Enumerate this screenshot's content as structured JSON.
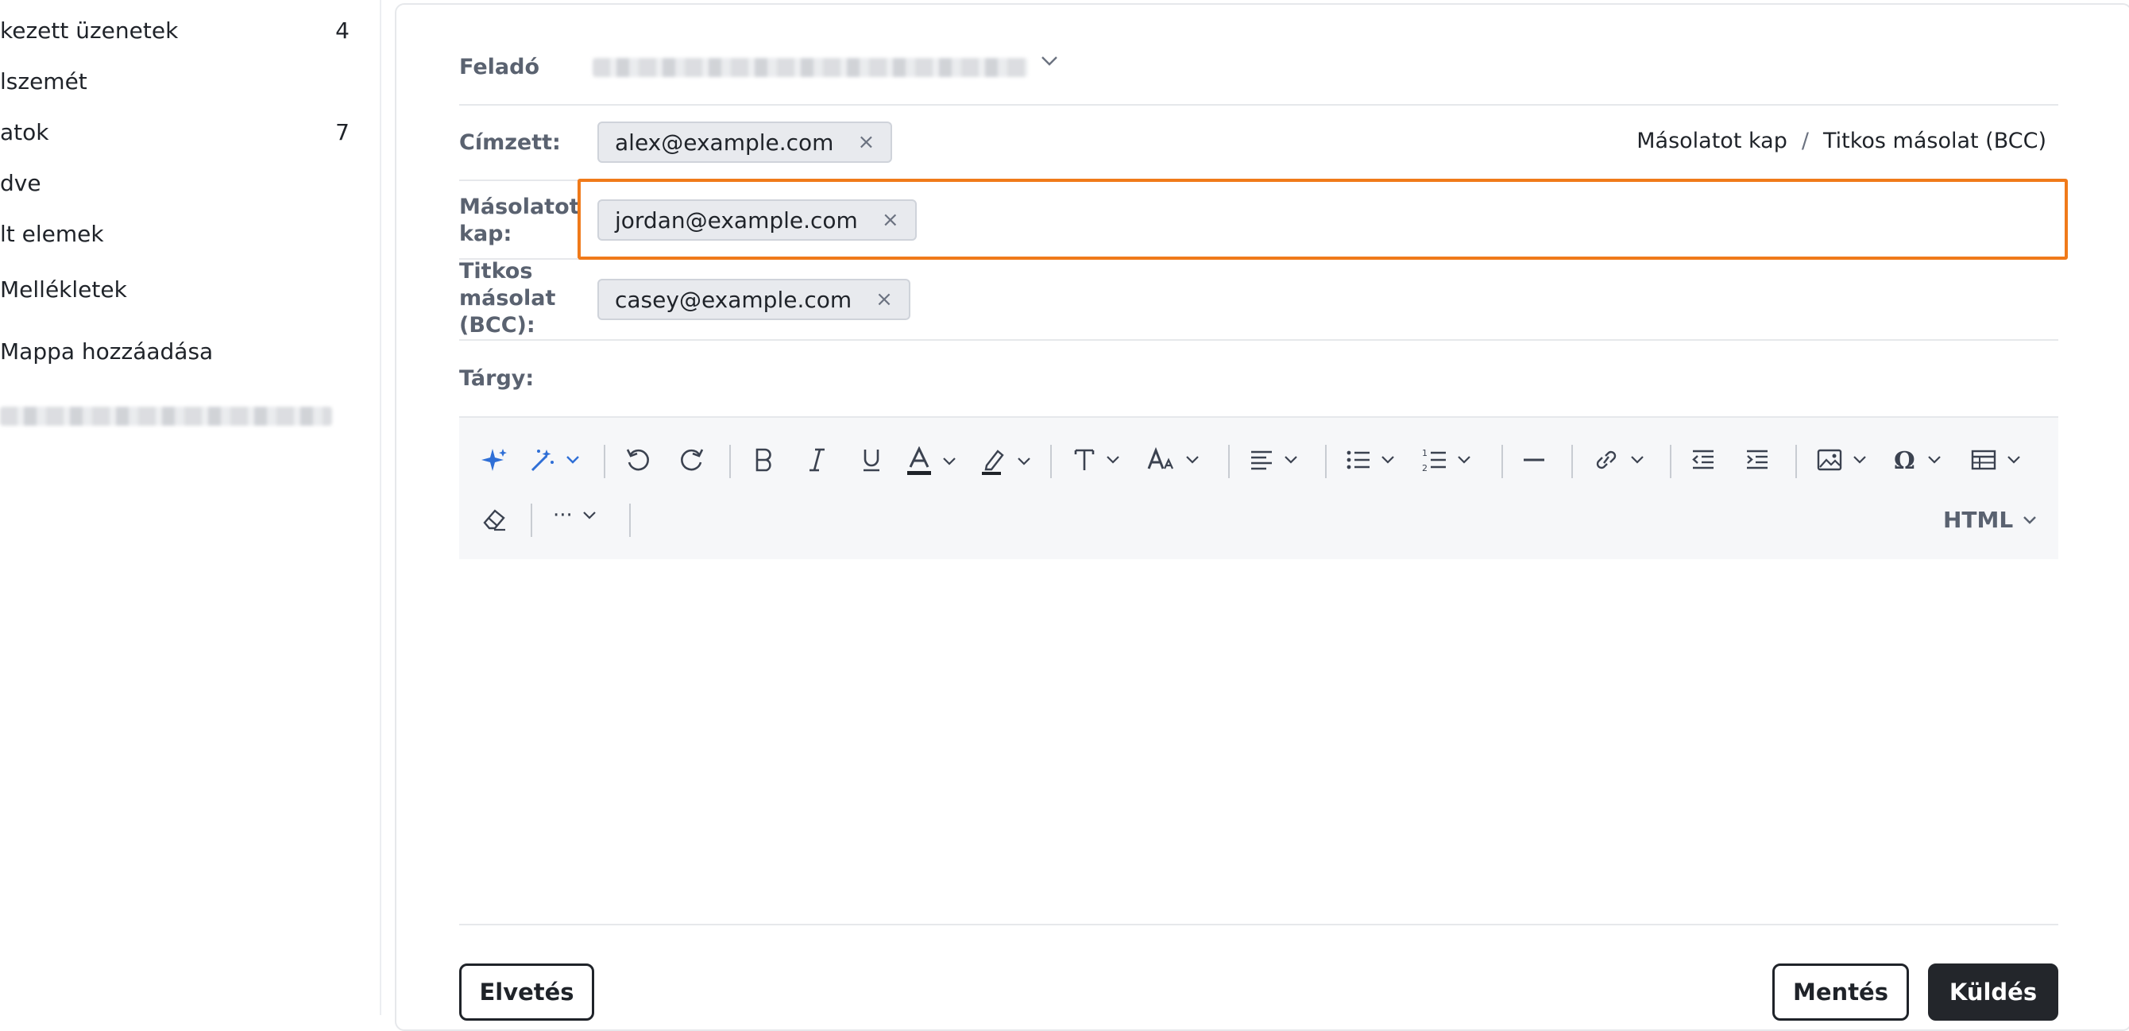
{
  "sidebar": {
    "items": [
      {
        "label": "kezett üzenetek",
        "count": "4"
      },
      {
        "label": "lszemét",
        "count": ""
      },
      {
        "label": "atok",
        "count": "7"
      },
      {
        "label": "dve",
        "count": ""
      },
      {
        "label": "lt elemek",
        "count": ""
      },
      {
        "label": "Mellékletek",
        "count": ""
      },
      {
        "label": "Mappa hozzáadása",
        "count": ""
      }
    ]
  },
  "compose": {
    "from_label": "Feladó",
    "to_label": "Címzett:",
    "to_chip": "alex@example.com",
    "cc_label": "Másolatot kap:",
    "cc_chip": "jordan@example.com",
    "bcc_label": "Titkos másolat (BCC):",
    "bcc_chip": "casey@example.com",
    "subject_label": "Tárgy:",
    "cc_link": "Másolatot kap",
    "link_separator": "/",
    "bcc_link": "Titkos másolat (BCC)",
    "chip_remove_glyph": "×"
  },
  "editor": {
    "mode_label": "HTML",
    "more_label": "···"
  },
  "footer": {
    "discard_label": "Elvetés",
    "save_label": "Mentés",
    "send_label": "Küldés"
  },
  "colors": {
    "focus_border": "#f07a1a",
    "ai_icon": "#2f6fd6",
    "send_button": "#23262b"
  },
  "icons": [
    "sparkle-icon",
    "magic-wand-icon",
    "undo-icon",
    "redo-icon",
    "bold-icon",
    "italic-icon",
    "underline-icon",
    "font-color-icon",
    "highlight-icon",
    "font-family-icon",
    "font-size-icon",
    "align-icon",
    "bulleted-list-icon",
    "numbered-list-icon",
    "horizontal-line-icon",
    "link-icon",
    "outdent-icon",
    "indent-icon",
    "image-icon",
    "special-char-icon",
    "table-icon",
    "eraser-icon"
  ]
}
